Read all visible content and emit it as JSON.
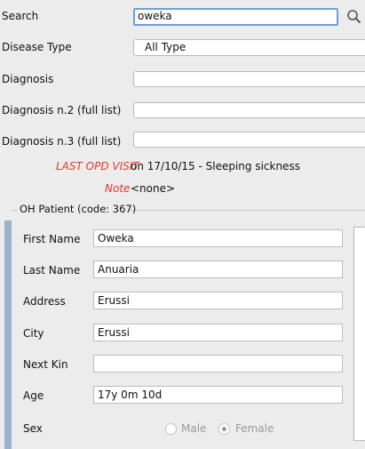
{
  "search": {
    "label": "Search",
    "value": "oweka"
  },
  "disease_type": {
    "label": "Disease Type",
    "value": "All Type"
  },
  "diagnosis": {
    "label": "Diagnosis",
    "value": ""
  },
  "diagnosis2": {
    "label": "Diagnosis n.2 (full list)",
    "value": ""
  },
  "diagnosis3": {
    "label": "Diagnosis n.3 (full list)",
    "value": ""
  },
  "last_visit": {
    "label": "LAST OPD VISIT",
    "value": "on 17/10/15 - Sleeping sickness"
  },
  "note": {
    "label": "Note",
    "value": "<none>"
  },
  "patient_panel": {
    "title": "OH Patient (code: 367)",
    "first_name": {
      "label": "First Name",
      "value": "Oweka"
    },
    "last_name": {
      "label": "Last Name",
      "value": "Anuaria"
    },
    "address": {
      "label": "Address",
      "value": "Erussi"
    },
    "city": {
      "label": "City",
      "value": "Erussi"
    },
    "next_kin": {
      "label": "Next Kin",
      "value": ""
    },
    "age": {
      "label": "Age",
      "value": "17y 0m 10d"
    },
    "sex": {
      "label": "Sex",
      "options": [
        "Male",
        "Female"
      ],
      "selected": "Female"
    }
  },
  "colors": {
    "accent": "#6f9ed8",
    "warning_label": "#e23a2e",
    "side_bar": "#9bb3cd"
  },
  "icons": {
    "search": "magnifier-icon"
  }
}
